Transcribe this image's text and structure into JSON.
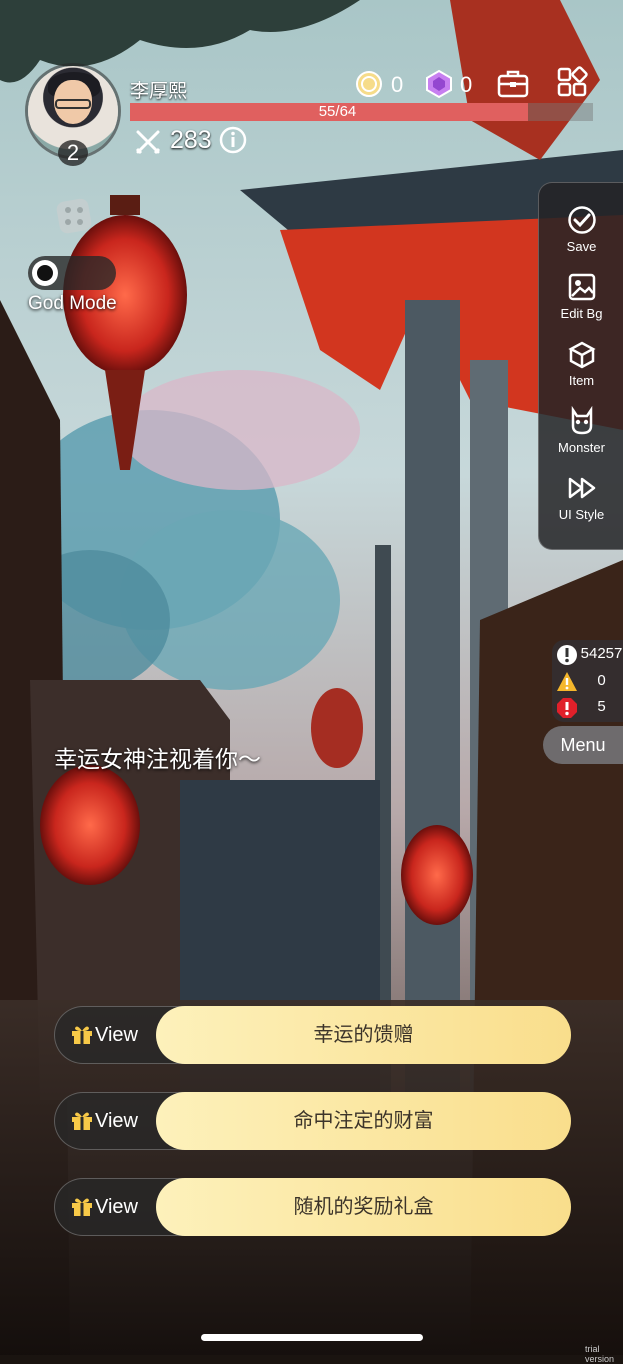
{
  "player": {
    "name": "李厚熙",
    "level": "2",
    "hp_text": "55/64",
    "hp_fraction": 0.859,
    "attack": "283"
  },
  "currency": {
    "coins": "0",
    "gems": "0"
  },
  "god_mode": {
    "label": "God Mode",
    "enabled": false
  },
  "side_panel": {
    "items": [
      {
        "label": "Save",
        "icon": "check-circle-icon"
      },
      {
        "label": "Edit Bg",
        "icon": "image-icon"
      },
      {
        "label": "Item",
        "icon": "box-icon"
      },
      {
        "label": "Monster",
        "icon": "monster-icon"
      },
      {
        "label": "UI Style",
        "icon": "fast-forward-icon"
      }
    ]
  },
  "counters": [
    {
      "icon": "info-circle-icon",
      "value": "54257",
      "color": "#ffffff"
    },
    {
      "icon": "warning-triangle-icon",
      "value": "0",
      "color": "#f5b72c"
    },
    {
      "icon": "error-octagon-icon",
      "value": "5",
      "color": "#e0202a"
    }
  ],
  "menu_label": "Menu",
  "blessing_text": "幸运女神注视着你～",
  "rewards": [
    {
      "view_label": "View",
      "title": "幸运的馈赠"
    },
    {
      "view_label": "View",
      "title": "命中注定的财富"
    },
    {
      "view_label": "View",
      "title": "随机的奖励礼盒"
    }
  ],
  "watermark": "trial version"
}
